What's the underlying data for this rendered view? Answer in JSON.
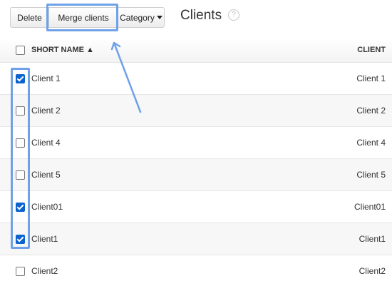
{
  "toolbar": {
    "delete_label": "Delete",
    "merge_label": "Merge clients",
    "category_label": "Category"
  },
  "page": {
    "title": "Clients",
    "help_icon": "?"
  },
  "table": {
    "columns": {
      "short_name": "SHORT NAME ▲",
      "client": "CLIENT"
    },
    "rows": [
      {
        "short_name": "Client 1",
        "client": "Client 1",
        "checked": true
      },
      {
        "short_name": "Client 2",
        "client": "Client 2",
        "checked": false
      },
      {
        "short_name": "Client 4",
        "client": "Client 4",
        "checked": false
      },
      {
        "short_name": "Client 5",
        "client": "Client 5",
        "checked": false
      },
      {
        "short_name": "Client01",
        "client": "Client01",
        "checked": true
      },
      {
        "short_name": "Client1",
        "client": "Client1",
        "checked": true
      },
      {
        "short_name": "Client2",
        "client": "Client2",
        "checked": false
      }
    ]
  },
  "colors": {
    "annotation": "#6fa1e8",
    "checkbox_checked": "#0b63ce"
  }
}
